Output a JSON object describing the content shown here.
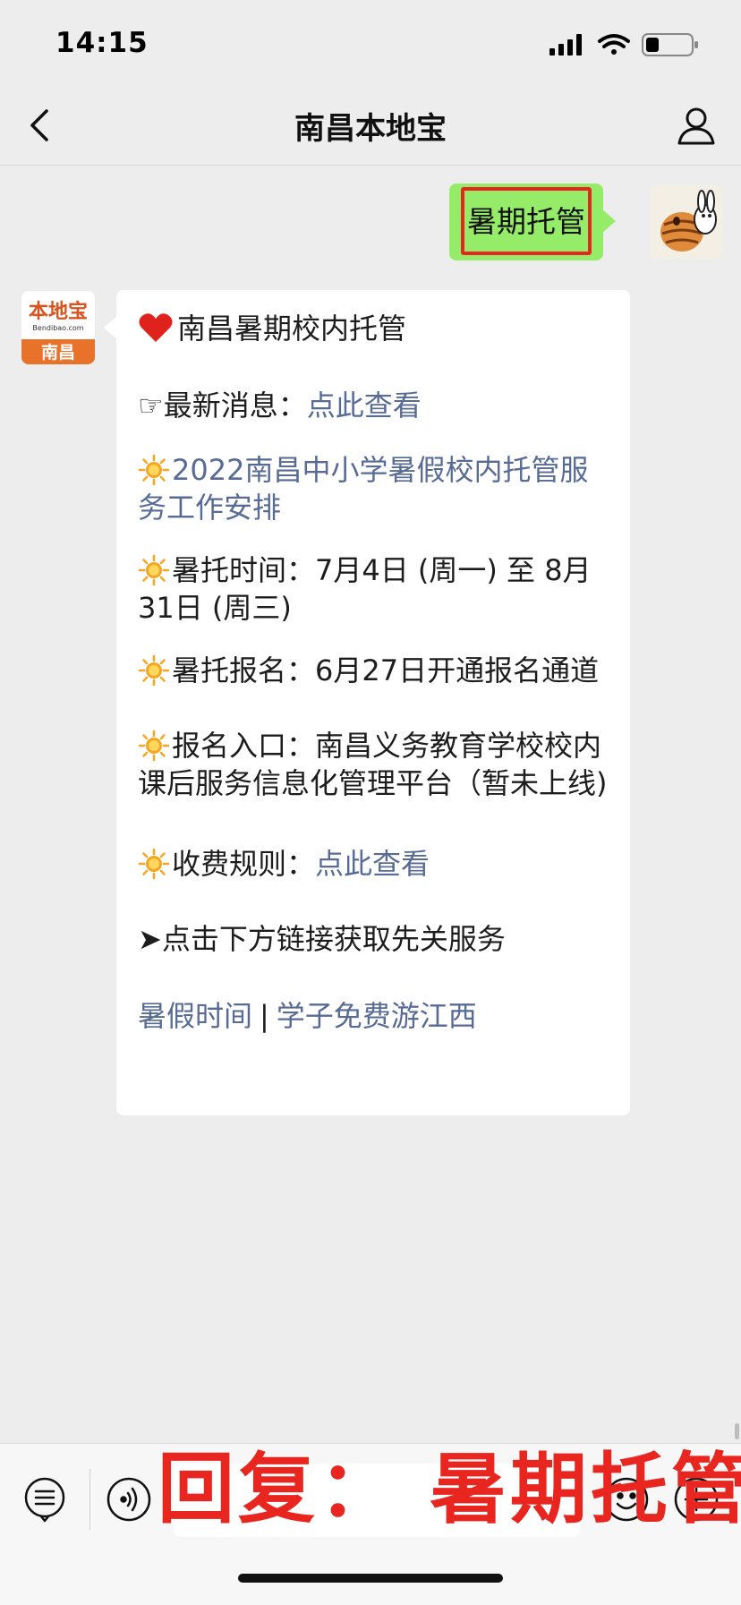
{
  "status": {
    "time": "14:15"
  },
  "nav": {
    "title": "南昌本地宝"
  },
  "sent": {
    "text": "暑期托管"
  },
  "bot_avatar": {
    "brand": "本地宝",
    "domain": "Bendibao.com",
    "city": "南昌"
  },
  "message": {
    "title": "南昌暑期校内托管",
    "latest_label": "☞最新消息：",
    "latest_link": "点此查看",
    "notice_link": "2022南昌中小学暑假校内托管服务工作安排",
    "time_text": "暑托时间：7月4日 (周一) 至 8月31日 (周三)",
    "signup_text": "暑托报名：6月27日开通报名通道",
    "entry_text": "报名入口：南昌义务教育学校校内课后服务信息化管理平台（暂未上线)",
    "fee_label": "收费规则：",
    "fee_link": "点此查看",
    "more_text": "➤点击下方链接获取先关服务",
    "footer_link_1": "暑假时间",
    "footer_sep": "|",
    "footer_link_2": "学子免费游江西"
  },
  "overlay": {
    "reply_text": "回复： 暑期托管"
  },
  "colors": {
    "link": "#576b95",
    "sent_bubble": "#95ec69",
    "highlight": "#e8261f",
    "brand_orange": "#e8722a"
  }
}
